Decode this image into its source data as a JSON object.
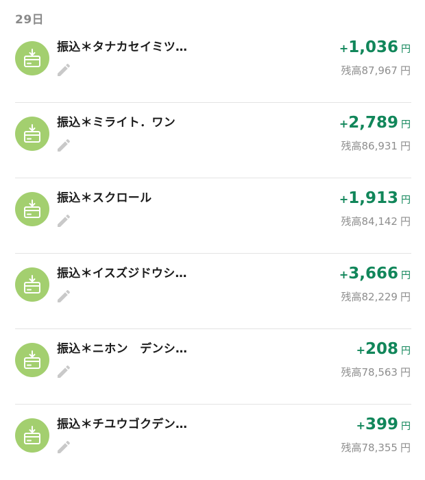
{
  "date_header": "29日",
  "currency_unit": "円",
  "colors": {
    "accent_green": "#11865a",
    "icon_circle": "#a3cf6f"
  },
  "icons": {
    "transaction": "deposit-card-icon",
    "edit": "pencil-icon"
  },
  "transactions": [
    {
      "description": "振込＊タナカセイミツ…",
      "sign": "+",
      "amount": "1,036",
      "balance": "残高87,967"
    },
    {
      "description": "振込＊ミライト．ワン",
      "sign": "+",
      "amount": "2,789",
      "balance": "残高86,931"
    },
    {
      "description": "振込＊スクロール",
      "sign": "+",
      "amount": "1,913",
      "balance": "残高84,142"
    },
    {
      "description": "振込＊イスズジドウシ…",
      "sign": "+",
      "amount": "3,666",
      "balance": "残高82,229"
    },
    {
      "description": "振込＊ニホン　デンシ…",
      "sign": "+",
      "amount": "208",
      "balance": "残高78,563"
    },
    {
      "description": "振込＊チユウゴクデン…",
      "sign": "+",
      "amount": "399",
      "balance": "残高78,355"
    }
  ]
}
